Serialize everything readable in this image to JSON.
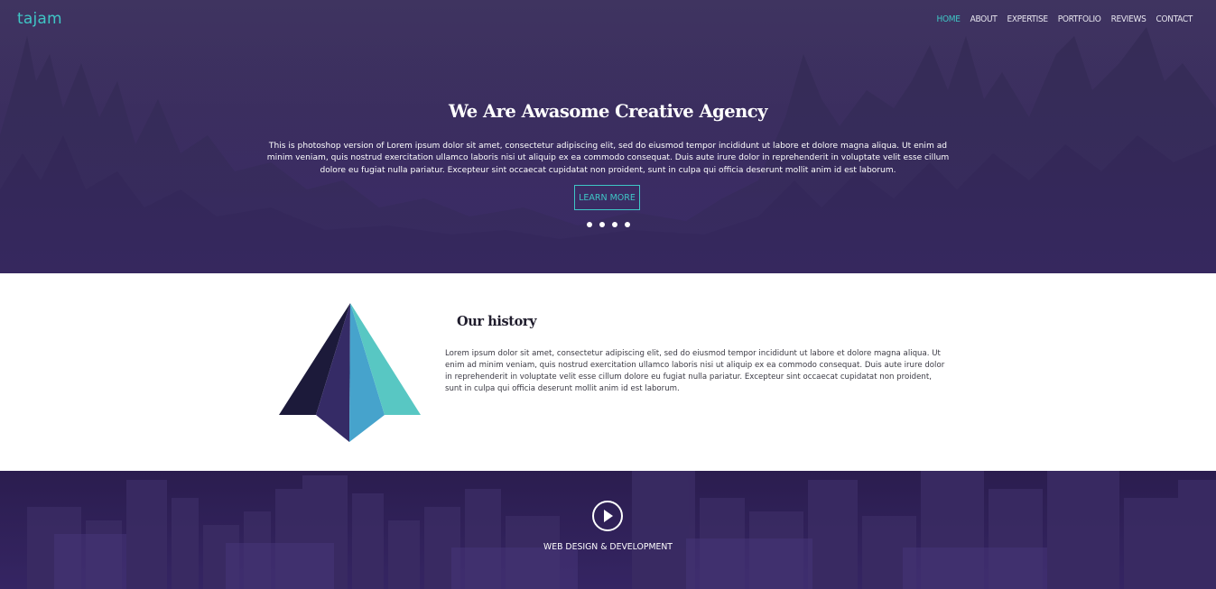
{
  "brand": {
    "logo_text": "tajam",
    "accent_color": "#3fc6c6"
  },
  "nav": {
    "items": [
      "HOME",
      "ABOUT",
      "EXPERTISE",
      "PORTFOLIO",
      "REVIEWS",
      "CONTACT"
    ],
    "active": "HOME"
  },
  "hero": {
    "title": "We Are Awasome Creative Agency",
    "text": "This is photoshop version of Lorem ipsum dolor sit amet, consectetur adipiscing elit, sed do eiusmod tempor incididunt ut labore et dolore magna aliqua. Ut enim ad minim veniam, quis nostrud exercitation ullamco laboris nisi ut aliquip ex ea commodo consequat. Duis aute irure dolor in reprehenderit in voluptate velit esse cillum dolore eu fugiat nulla pariatur. Excepteur sint occaecat cupidatat non proident, sunt in culpa qui officia deserunt mollit anim id est laborum.",
    "button_label": "LEARN MORE",
    "slide_count": 4,
    "background_color": "#3b2d60"
  },
  "history": {
    "title": "Our history",
    "text": "Lorem ipsum dolor sit amet, consectetur adipiscing elit, sed do eiusmod tempor incididunt ut labore et dolore magna aliqua. Ut enim ad minim veniam, quis nostrud exercitation ullamco laboris nisi ut aliquip ex ea commodo consequat. Duis aute irure dolor in reprehenderit in voluptate velit esse cillum dolore eu fugiat nulla pariatur. Excepteur sint occaecat cupidatat non proident, sunt in culpa qui officia deserunt mollit anim id est laborum.",
    "illustration_colors": [
      "#1c1a3a",
      "#352b66",
      "#46a3cc",
      "#58c7c3"
    ]
  },
  "video": {
    "play_icon": "play-icon",
    "label": "WEB DESIGN & DEVELOPMENT"
  }
}
